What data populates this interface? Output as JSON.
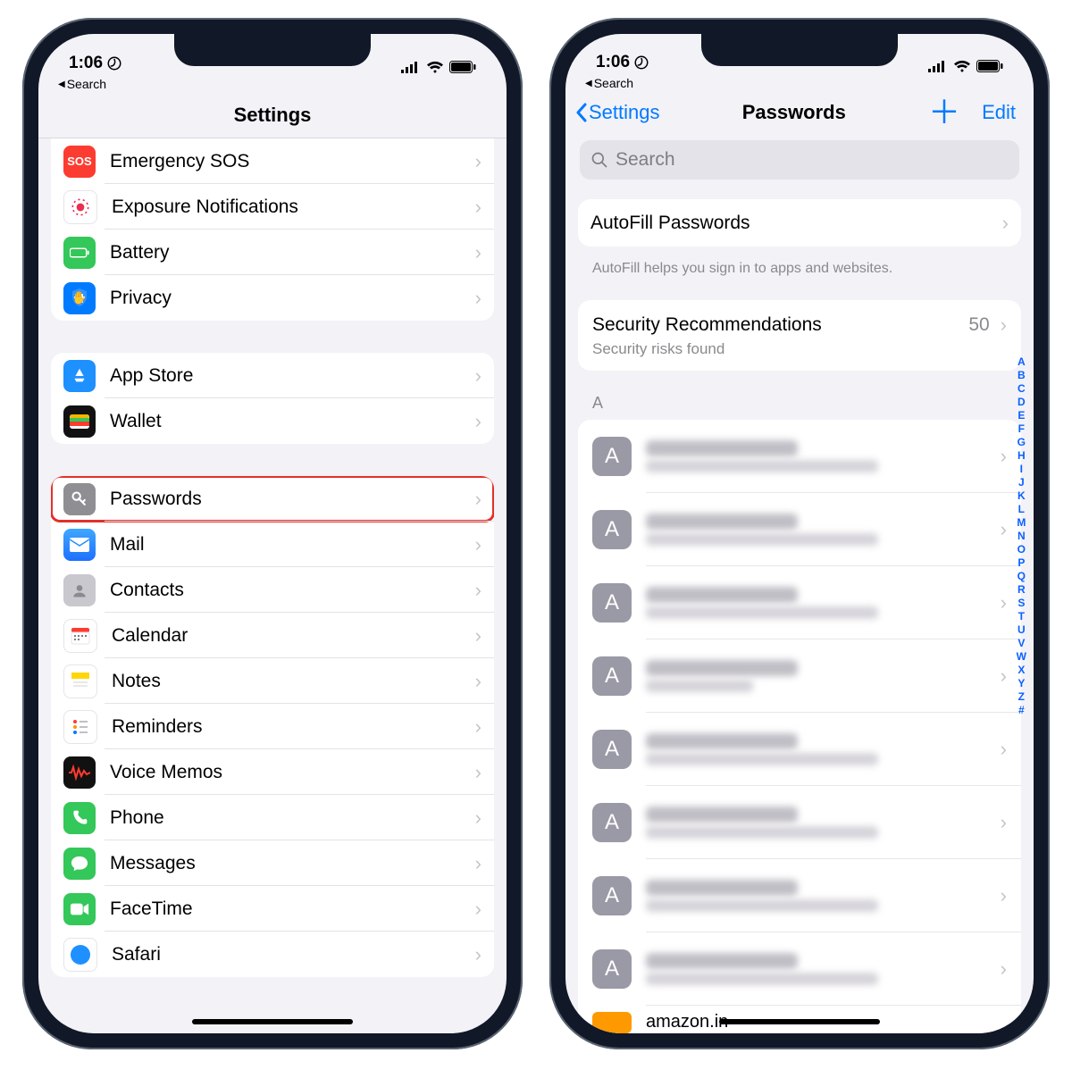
{
  "statusbar": {
    "time": "1:06",
    "back_label": "Search"
  },
  "left_phone": {
    "title": "Settings",
    "group1": [
      {
        "id": "sos",
        "label": "Emergency SOS",
        "color": "#fc3c30",
        "glyph": "SOS"
      },
      {
        "id": "exposure",
        "label": "Exposure Notifications",
        "color": "#ffffff"
      },
      {
        "id": "battery",
        "label": "Battery",
        "color": "#34c759"
      },
      {
        "id": "privacy",
        "label": "Privacy",
        "color": "#007aff"
      }
    ],
    "group2": [
      {
        "id": "appstore",
        "label": "App Store",
        "color": "#1e90ff"
      },
      {
        "id": "wallet",
        "label": "Wallet",
        "color": "#111"
      }
    ],
    "group3": [
      {
        "id": "passwords",
        "label": "Passwords",
        "color": "#8e8e93",
        "highlight": true
      },
      {
        "id": "mail",
        "label": "Mail",
        "color": "#1e90ff"
      },
      {
        "id": "contacts",
        "label": "Contacts",
        "color": "#bdbcc2"
      },
      {
        "id": "calendar",
        "label": "Calendar",
        "color": "#ffffff"
      },
      {
        "id": "notes",
        "label": "Notes",
        "color": "#ffd60a"
      },
      {
        "id": "reminders",
        "label": "Reminders",
        "color": "#ffffff"
      },
      {
        "id": "voicememos",
        "label": "Voice Memos",
        "color": "#111"
      },
      {
        "id": "phone",
        "label": "Phone",
        "color": "#34c759"
      },
      {
        "id": "messages",
        "label": "Messages",
        "color": "#34c759"
      },
      {
        "id": "facetime",
        "label": "FaceTime",
        "color": "#34c759"
      },
      {
        "id": "safari",
        "label": "Safari",
        "color": "#ffffff"
      }
    ]
  },
  "right_phone": {
    "back_label": "Settings",
    "title": "Passwords",
    "edit_label": "Edit",
    "search_placeholder": "Search",
    "autofill": {
      "label": "AutoFill Passwords",
      "footer": "AutoFill helps you sign in to apps and websites."
    },
    "security": {
      "label": "Security Recommendations",
      "sub": "Security risks found",
      "count": "50"
    },
    "section_letter": "A",
    "visible_entry": "amazon.in",
    "index_rail": [
      "A",
      "B",
      "C",
      "D",
      "E",
      "F",
      "G",
      "H",
      "I",
      "J",
      "K",
      "L",
      "M",
      "N",
      "O",
      "P",
      "Q",
      "R",
      "S",
      "T",
      "U",
      "V",
      "W",
      "X",
      "Y",
      "Z",
      "#"
    ]
  }
}
